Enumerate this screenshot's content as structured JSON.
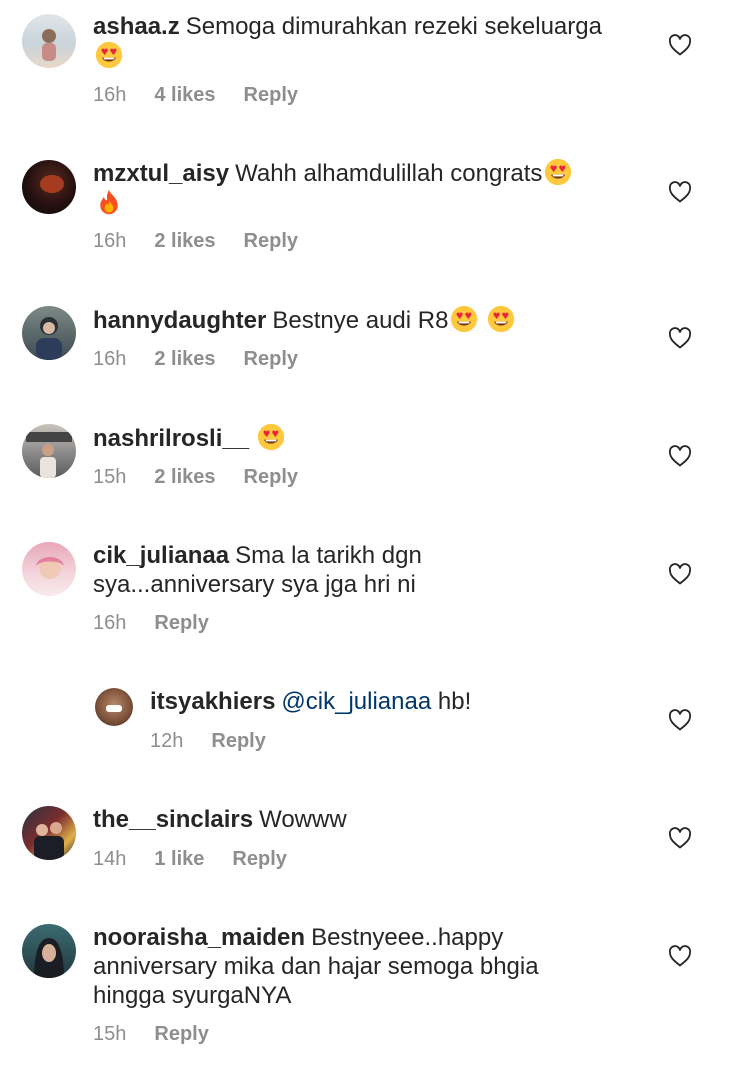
{
  "comments": [
    {
      "user": "ashaa.z",
      "body": "Semoga dimurahkan rezeki sekeluarga",
      "time": "16h",
      "likes": "4 likes",
      "reply": "Reply",
      "emojis": [
        "heart-eyes"
      ]
    },
    {
      "user": "mzxtul_aisy",
      "body": "Wahh alhamdulillah congrats",
      "time": "16h",
      "likes": "2 likes",
      "reply": "Reply",
      "emojis": [
        "heart-eyes",
        "fire"
      ]
    },
    {
      "user": "hannydaughter",
      "body": "Bestnye audi R8",
      "time": "16h",
      "likes": "2 likes",
      "reply": "Reply",
      "emojis": [
        "heart-eyes",
        "heart-eyes"
      ]
    },
    {
      "user": "nashrilrosli__",
      "body": "",
      "time": "15h",
      "likes": "2 likes",
      "reply": "Reply",
      "emojis": [
        "heart-eyes"
      ]
    },
    {
      "user": "cik_julianaa",
      "body": "Sma la tarikh dgn sya...anniversary sya jga hri ni",
      "time": "16h",
      "likes": "",
      "reply": "Reply",
      "emojis": []
    },
    {
      "user": "itsyakhiers",
      "mention": "@cik_julianaa",
      "body": "hb!",
      "time": "12h",
      "likes": "",
      "reply": "Reply",
      "emojis": []
    },
    {
      "user": "the__sinclairs",
      "body": "Wowww",
      "time": "14h",
      "likes": "1 like",
      "reply": "Reply",
      "emojis": []
    },
    {
      "user": "nooraisha_maiden",
      "body": "Bestnyeee..happy anniversary mika dan hajar semoga bhgia hingga syurgaNYA",
      "time": "15h",
      "likes": "",
      "reply": "Reply",
      "emojis": []
    }
  ],
  "colors": {
    "text": "#262626",
    "meta": "#8e8e8e",
    "mention": "#00376b"
  }
}
